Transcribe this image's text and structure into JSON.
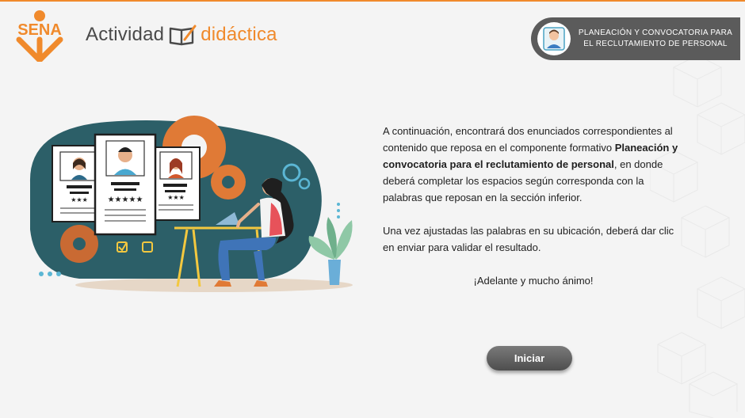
{
  "header": {
    "logo_text": "SENA",
    "title_part1": "Actividad",
    "title_part2": "didáctica",
    "badge_line1": "PLANEACIÓN Y CONVOCATORIA PARA",
    "badge_line2": "EL RECLUTAMIENTO DE PERSONAL"
  },
  "content": {
    "p1_before": "A continuación, encontrará dos enunciados correspondientes al contenido que reposa en el componente formativo ",
    "p1_bold": "Planeación y convocatoria para el reclutamiento de personal",
    "p1_after": ", en donde deberá completar los espacios según corresponda con la palabras que reposan en la sección inferior.",
    "p2": "Una vez ajustadas las palabras en su ubicación, deberá dar clic en enviar para validar el resultado.",
    "p3": "¡Adelante y mucho ánimo!"
  },
  "actions": {
    "start_label": "Iniciar"
  },
  "colors": {
    "accent": "#f08a2c",
    "teal": "#2c5f68",
    "badge_bg": "#5b5b5b"
  }
}
